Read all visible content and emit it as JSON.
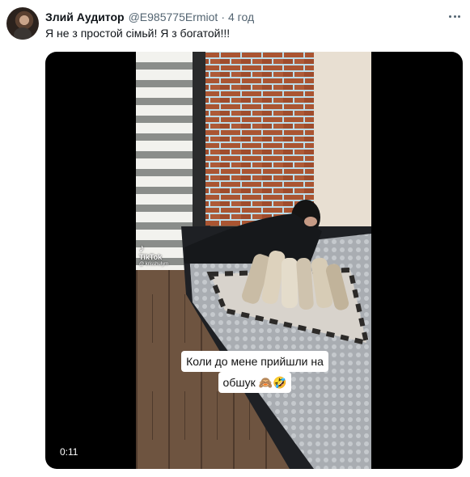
{
  "tweet": {
    "author_name": "Злий Аудитор",
    "author_handle": "@E985775Ermiot",
    "separator": "·",
    "time": "4 год",
    "text": "Я не з простой сімьй!  Я з богатой!!!"
  },
  "video": {
    "watermark_logo": "♪",
    "watermark_name": "TikTok",
    "watermark_user": "@ krisshulym",
    "caption_line1": "Коли до мене прийшли на",
    "caption_line2": "обшук 🙈🤣",
    "duration": "0:11"
  },
  "icons": [
    "more-icon",
    "tiktok-logo-icon"
  ]
}
